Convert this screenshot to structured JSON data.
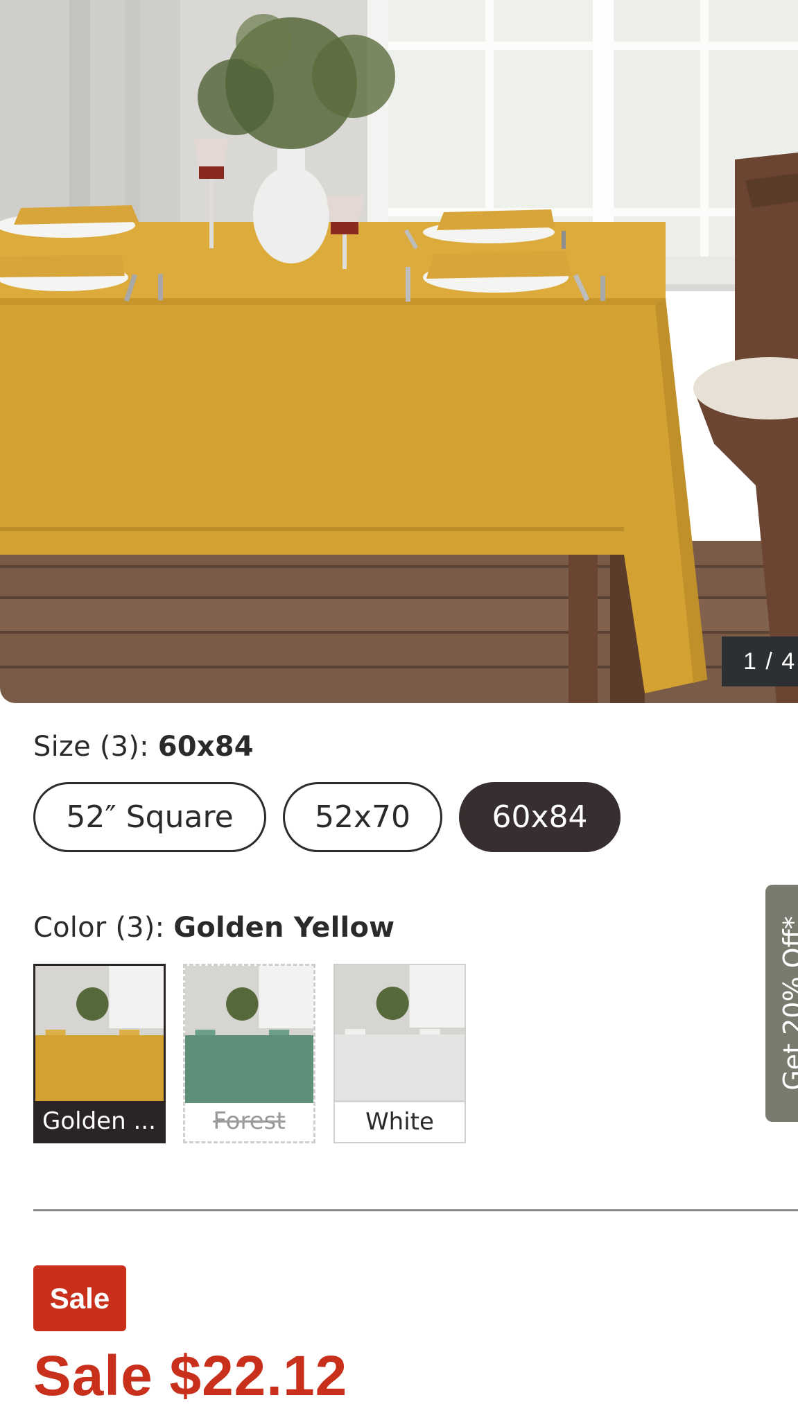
{
  "gallery": {
    "counter": "1 / 4"
  },
  "size": {
    "label": "Size (3):",
    "selected_value": "60x84",
    "options": [
      "52″ Square",
      "52x70",
      "60x84"
    ]
  },
  "color": {
    "label": "Color (3):",
    "selected_value": "Golden Yellow",
    "options": [
      {
        "name": "Golden ...",
        "state": "selected",
        "cloth": "#d3a233"
      },
      {
        "name": "Forest",
        "state": "unavailable",
        "cloth": "#5e8f78"
      },
      {
        "name": "White",
        "state": "available",
        "cloth": "#e4e4e2"
      }
    ]
  },
  "promo_tab": {
    "text": "Get 20% Off*"
  },
  "pricing": {
    "badge": "Sale",
    "price": "Sale $22.12"
  },
  "colors": {
    "sale_red": "#c8301c",
    "selected_dark": "#372f2f",
    "tablecloth_gold": "#d3a233"
  }
}
